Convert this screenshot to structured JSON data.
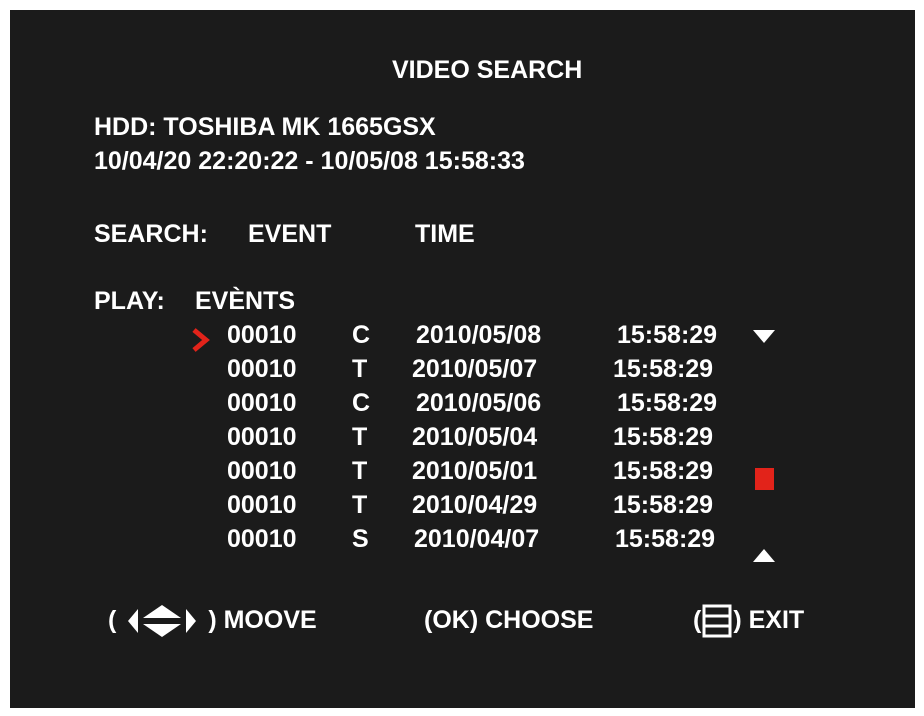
{
  "screen": {
    "title": "VIDEO SEARCH",
    "hdd": "HDD: TOSHIBA MK 1665GSX",
    "range": "10/04/20  22:20:22  - 10/05/08 15:58:33"
  },
  "search": {
    "label": "SEARCH:",
    "options": [
      "EVENT",
      "TIME"
    ]
  },
  "play": {
    "label": "PLAY:",
    "value": "EVÈNTS"
  },
  "events": [
    {
      "number": "00010",
      "type": "C",
      "date": "2010/05/08",
      "time": "15:58:29"
    },
    {
      "number": "00010",
      "type": "T",
      "date": "2010/05/07",
      "time": "15:58:29"
    },
    {
      "number": "00010",
      "type": "C",
      "date": "2010/05/06",
      "time": "15:58:29"
    },
    {
      "number": "00010",
      "type": "T",
      "date": "2010/05/04",
      "time": "15:58:29"
    },
    {
      "number": "00010",
      "type": "T",
      "date": "2010/05/01",
      "time": "15:58:29"
    },
    {
      "number": "00010",
      "type": "T",
      "date": "2010/04/29",
      "time": "15:58:29"
    },
    {
      "number": "00010",
      "type": "S",
      "date": "2010/04/07",
      "time": "15:58:29"
    }
  ],
  "selected_index": 0,
  "footer": {
    "move_open": "(",
    "move_label": ") MOOVE",
    "choose_label": "(OK) CHOOSE",
    "exit_open": "(",
    "exit_label": ") EXIT"
  },
  "colors": {
    "background": "#1b1b1b",
    "text": "#ffffff",
    "accent": "#e2231a"
  },
  "icons": {
    "cursor": "chevron-right-icon",
    "scroll_down": "triangle-down-icon",
    "scroll_up": "triangle-up-icon",
    "scroll_thumb": "scroll-thumb",
    "move": "direction-arrows-icon",
    "exit": "menu-icon"
  }
}
